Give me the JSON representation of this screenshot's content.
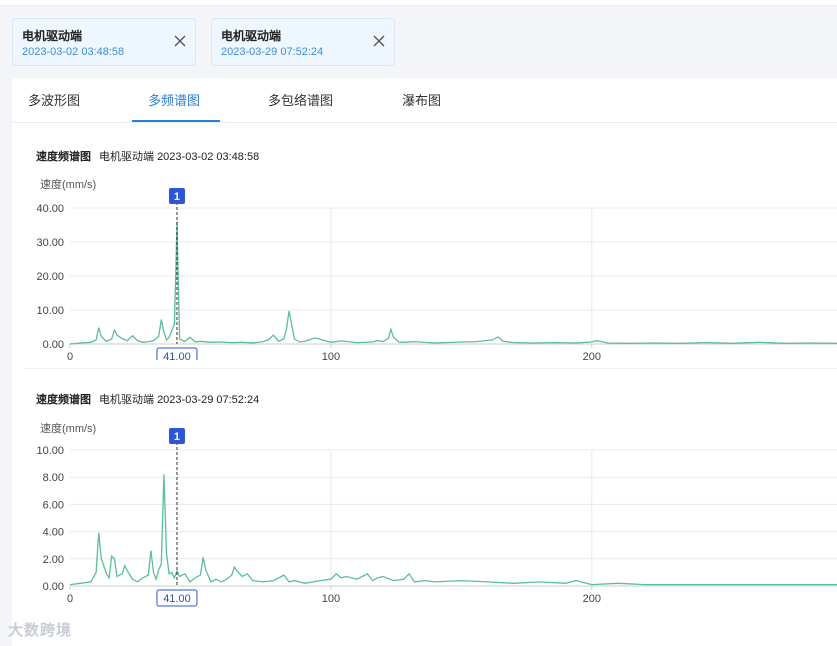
{
  "open_files": [
    {
      "name": "电机驱动端",
      "time": "2023-03-02 03:48:58"
    },
    {
      "name": "电机驱动端",
      "time": "2023-03-29 07:52:24"
    }
  ],
  "tabs": [
    {
      "label": "多波形图",
      "active": false
    },
    {
      "label": "多频谱图",
      "active": true
    },
    {
      "label": "多包络谱图",
      "active": false
    },
    {
      "label": "瀑布图",
      "active": false
    }
  ],
  "colors": {
    "accent": "#2b7cd3",
    "series": "#5bbf96",
    "marker": "#2d55d6"
  },
  "icons": {
    "close": "close-icon"
  },
  "watermark": "大数跨境",
  "chart_data": [
    {
      "type": "line",
      "title_kind": "速度频谱图",
      "title_name": "电机驱动端",
      "title_time": "2023-03-02 03:48:58",
      "ylabel": "速度(mm/s)",
      "ylim": [
        0,
        40
      ],
      "yticks": [
        "0.00",
        "10.00",
        "20.00",
        "30.00",
        "40.00"
      ],
      "xticks": [
        0,
        100,
        200
      ],
      "xlim": [
        0,
        294
      ],
      "cursor": {
        "x": 41,
        "label": "41.00",
        "marker": "1"
      },
      "x": [
        0,
        4,
        8,
        10,
        11,
        12,
        14,
        16,
        17,
        18,
        20,
        22,
        24,
        26,
        28,
        30,
        32,
        34,
        35,
        36,
        37,
        38,
        40,
        40.5,
        41,
        41.5,
        42,
        44,
        46,
        48,
        50,
        54,
        58,
        62,
        66,
        70,
        74,
        76,
        78,
        80,
        82,
        83,
        84,
        86,
        88,
        90,
        94,
        100,
        104,
        110,
        116,
        118,
        120,
        122,
        123,
        124,
        126,
        128,
        132,
        140,
        150,
        156,
        162,
        164,
        166,
        170,
        178,
        186,
        194,
        200,
        202,
        206,
        214,
        224,
        234,
        244,
        254,
        264,
        274,
        284,
        294
      ],
      "y": [
        0,
        0.3,
        0.5,
        1.2,
        4.8,
        2.2,
        0.8,
        1.5,
        4.1,
        2.6,
        1.6,
        1.0,
        2.4,
        0.9,
        0.5,
        0.7,
        1.0,
        2.2,
        7.2,
        3.5,
        1.2,
        2.0,
        5.8,
        20,
        36,
        18,
        1.5,
        0.7,
        2.0,
        0.6,
        0.8,
        0.5,
        0.6,
        0.4,
        0.5,
        0.3,
        0.7,
        1.2,
        2.6,
        0.8,
        1.5,
        4.5,
        9.7,
        1.5,
        0.6,
        0.8,
        1.8,
        0.5,
        0.9,
        0.4,
        0.6,
        1.0,
        0.7,
        1.6,
        4.3,
        2.0,
        0.6,
        0.5,
        0.7,
        0.3,
        0.6,
        0.7,
        1.2,
        2.1,
        0.8,
        0.4,
        0.3,
        0.4,
        0.3,
        0.6,
        1.0,
        0.3,
        0.2,
        0.3,
        0.2,
        0.4,
        0.2,
        0.5,
        0.2,
        0.3,
        0.2
      ]
    },
    {
      "type": "line",
      "title_kind": "速度频谱图",
      "title_name": "电机驱动端",
      "title_time": "2023-03-29 07:52:24",
      "ylabel": "速度(mm/s)",
      "ylim": [
        0,
        10
      ],
      "yticks": [
        "0.00",
        "2.00",
        "4.00",
        "6.00",
        "8.00",
        "10.00"
      ],
      "xticks": [
        0,
        100,
        200
      ],
      "xlim": [
        0,
        294
      ],
      "cursor": {
        "x": 41,
        "label": "41.00",
        "marker": "1"
      },
      "x": [
        0,
        4,
        8,
        10,
        11,
        12,
        14,
        15,
        16,
        17,
        18,
        20,
        21,
        22,
        24,
        26,
        28,
        30,
        31,
        32,
        33,
        34,
        35,
        36,
        37,
        38,
        39,
        40,
        41,
        42,
        44,
        46,
        48,
        50,
        51,
        52,
        54,
        56,
        58,
        60,
        62,
        63,
        64,
        66,
        68,
        70,
        74,
        78,
        82,
        84,
        86,
        90,
        96,
        100,
        102,
        104,
        106,
        110,
        114,
        116,
        118,
        120,
        124,
        128,
        130,
        132,
        136,
        140,
        150,
        160,
        170,
        180,
        190,
        194,
        200,
        210,
        220,
        230,
        240,
        250,
        260,
        270,
        280,
        290,
        294
      ],
      "y": [
        0.1,
        0.2,
        0.3,
        1.0,
        3.9,
        2.0,
        0.9,
        0.6,
        2.2,
        2.0,
        0.7,
        0.9,
        1.5,
        1.1,
        0.5,
        0.3,
        0.6,
        0.8,
        2.6,
        1.0,
        0.5,
        1.2,
        1.6,
        8.2,
        2.4,
        0.9,
        1.0,
        0.6,
        1.1,
        0.7,
        0.9,
        0.3,
        0.6,
        0.8,
        2.1,
        1.2,
        0.3,
        0.5,
        0.3,
        0.5,
        0.8,
        1.4,
        1.1,
        0.7,
        0.9,
        0.4,
        0.3,
        0.4,
        0.8,
        0.3,
        0.4,
        0.2,
        0.4,
        0.5,
        0.9,
        0.6,
        0.7,
        0.5,
        0.9,
        0.4,
        0.6,
        0.7,
        0.4,
        0.5,
        0.9,
        0.3,
        0.4,
        0.3,
        0.4,
        0.3,
        0.2,
        0.3,
        0.2,
        0.4,
        0.1,
        0.2,
        0.1,
        0.1,
        0.1,
        0.1,
        0.1,
        0.1,
        0.1,
        0.1,
        0.1
      ]
    }
  ]
}
